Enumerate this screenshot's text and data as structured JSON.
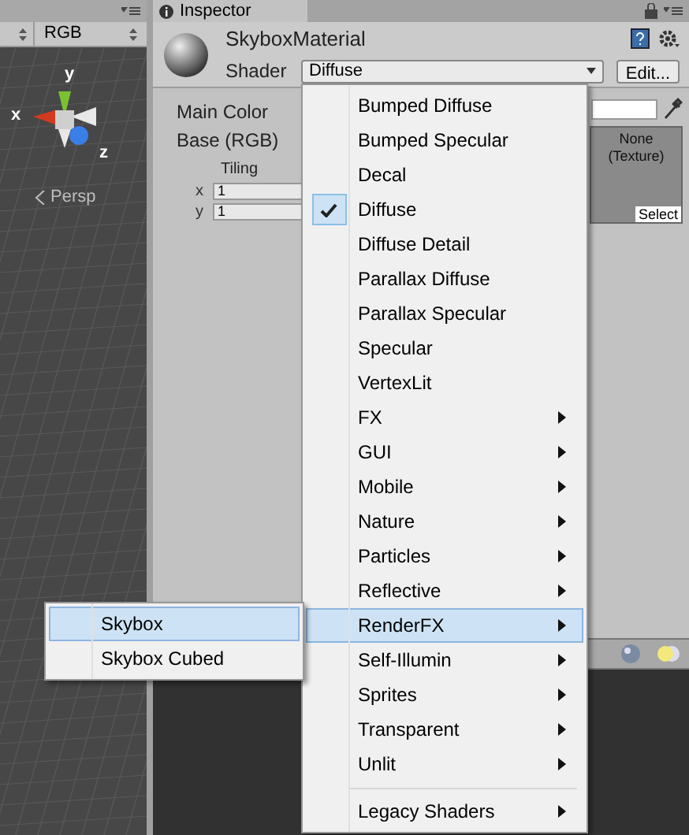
{
  "scene_view": {
    "render_mode": "RGB",
    "axis_labels": [
      "y",
      "x",
      "z"
    ],
    "projection": "Persp"
  },
  "inspector": {
    "tab": "Inspector",
    "material": "SkyboxMaterial",
    "shader_label": "Shader",
    "shader_value": "Diffuse",
    "edit_button": "Edit...",
    "properties": [
      "Main Color",
      "Base (RGB)"
    ],
    "tiling": {
      "label": "Tiling",
      "rows": [
        {
          "axis": "x",
          "value": "1"
        },
        {
          "axis": "y",
          "value": "1"
        }
      ]
    },
    "texture": {
      "label": "None (Texture)",
      "button": "Select"
    }
  },
  "shader_menu": [
    {
      "label": "Bumped Diffuse",
      "kind": "item",
      "checked": false,
      "highlighted": false
    },
    {
      "label": "Bumped Specular",
      "kind": "item",
      "checked": false,
      "highlighted": false
    },
    {
      "label": "Decal",
      "kind": "item",
      "checked": false,
      "highlighted": false
    },
    {
      "label": "Diffuse",
      "kind": "item",
      "checked": true,
      "highlighted": false
    },
    {
      "label": "Diffuse Detail",
      "kind": "item",
      "checked": false,
      "highlighted": false
    },
    {
      "label": "Parallax Diffuse",
      "kind": "item",
      "checked": false,
      "highlighted": false
    },
    {
      "label": "Parallax Specular",
      "kind": "item",
      "checked": false,
      "highlighted": false
    },
    {
      "label": "Specular",
      "kind": "item",
      "checked": false,
      "highlighted": false
    },
    {
      "label": "VertexLit",
      "kind": "item",
      "checked": false,
      "highlighted": false
    },
    {
      "label": "FX",
      "kind": "submenu",
      "checked": false,
      "highlighted": false
    },
    {
      "label": "GUI",
      "kind": "submenu",
      "checked": false,
      "highlighted": false
    },
    {
      "label": "Mobile",
      "kind": "submenu",
      "checked": false,
      "highlighted": false
    },
    {
      "label": "Nature",
      "kind": "submenu",
      "checked": false,
      "highlighted": false
    },
    {
      "label": "Particles",
      "kind": "submenu",
      "checked": false,
      "highlighted": false
    },
    {
      "label": "Reflective",
      "kind": "submenu",
      "checked": false,
      "highlighted": false
    },
    {
      "label": "RenderFX",
      "kind": "submenu",
      "checked": false,
      "highlighted": true
    },
    {
      "label": "Self-Illumin",
      "kind": "submenu",
      "checked": false,
      "highlighted": false
    },
    {
      "label": "Sprites",
      "kind": "submenu",
      "checked": false,
      "highlighted": false
    },
    {
      "label": "Transparent",
      "kind": "submenu",
      "checked": false,
      "highlighted": false
    },
    {
      "label": "Unlit",
      "kind": "submenu",
      "checked": false,
      "highlighted": false
    },
    {
      "kind": "separator"
    },
    {
      "label": "Legacy Shaders",
      "kind": "submenu",
      "checked": false,
      "highlighted": false
    }
  ],
  "submenu": [
    {
      "label": "Skybox",
      "highlighted": true
    },
    {
      "label": "Skybox Cubed",
      "highlighted": false
    }
  ]
}
